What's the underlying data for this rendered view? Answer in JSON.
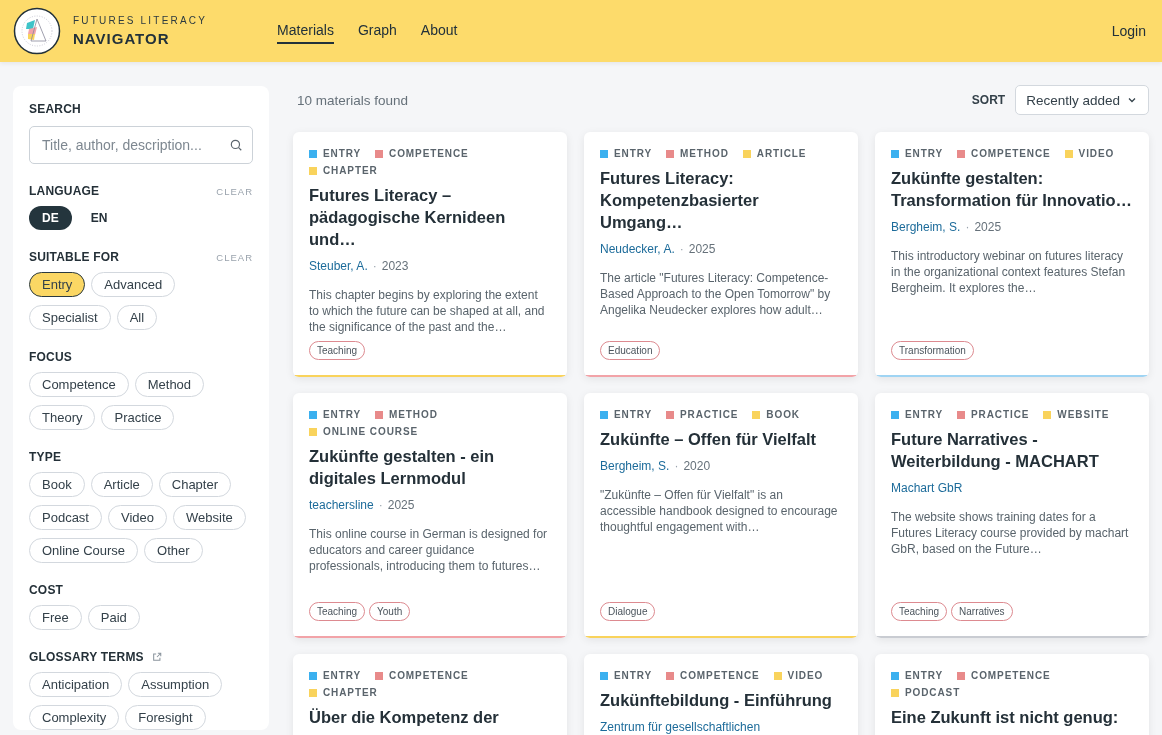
{
  "header": {
    "brand_top": "FUTURES LITERACY",
    "brand_main": "NAVIGATOR",
    "nav": [
      {
        "label": "Materials",
        "selected": true
      },
      {
        "label": "Graph",
        "selected": false
      },
      {
        "label": "About",
        "selected": false
      }
    ],
    "login": "Login"
  },
  "sidebar": {
    "search": {
      "title": "SEARCH",
      "placeholder": "Title, author, description..."
    },
    "sections": [
      {
        "title": "LANGUAGE",
        "kind": "toggle",
        "clear": "CLEAR",
        "options": [
          {
            "label": "DE",
            "selected": true
          },
          {
            "label": "EN",
            "selected": false
          }
        ]
      },
      {
        "title": "SUITABLE FOR",
        "kind": "chips",
        "clear": "CLEAR",
        "options": [
          {
            "label": "Entry",
            "selected": true
          },
          {
            "label": "Advanced",
            "selected": false
          },
          {
            "label": "Specialist",
            "selected": false
          },
          {
            "label": "All",
            "selected": false
          }
        ]
      },
      {
        "title": "FOCUS",
        "kind": "chips",
        "options": [
          {
            "label": "Competence",
            "selected": false
          },
          {
            "label": "Method",
            "selected": false
          },
          {
            "label": "Theory",
            "selected": false
          },
          {
            "label": "Practice",
            "selected": false
          }
        ]
      },
      {
        "title": "TYPE",
        "kind": "chips",
        "options": [
          {
            "label": "Book",
            "selected": false
          },
          {
            "label": "Article",
            "selected": false
          },
          {
            "label": "Chapter",
            "selected": false
          },
          {
            "label": "Podcast",
            "selected": false
          },
          {
            "label": "Video",
            "selected": false
          },
          {
            "label": "Website",
            "selected": false
          },
          {
            "label": "Online Course",
            "selected": false
          },
          {
            "label": "Other",
            "selected": false
          }
        ]
      },
      {
        "title": "COST",
        "kind": "chips",
        "options": [
          {
            "label": "Free",
            "selected": false
          },
          {
            "label": "Paid",
            "selected": false
          }
        ]
      },
      {
        "title": "GLOSSARY TERMS",
        "kind": "chips",
        "external_link": true,
        "options": [
          {
            "label": "Anticipation",
            "selected": false
          },
          {
            "label": "Assumption",
            "selected": false
          },
          {
            "label": "Complexity",
            "selected": false
          },
          {
            "label": "Foresight",
            "selected": false
          }
        ]
      }
    ]
  },
  "results": {
    "count": "10 materials found",
    "sort_label": "SORT",
    "sort_value": "Recently added",
    "cards": [
      {
        "color": "#f9d35c",
        "tags": [
          {
            "label": "ENTRY",
            "color": "#3bb0ef"
          },
          {
            "label": "COMPETENCE",
            "color": "#e88a8a"
          },
          {
            "label": "CHAPTER",
            "color": "#f9d35c"
          }
        ],
        "title": "Futures Literacy – pädagogische Kernideen und…",
        "author": "Steuber, A.",
        "separator": "·",
        "year": "2023",
        "description": "This chapter begins by exploring the extent to which the future can be shaped at all, and the significance of the past and the…",
        "keywords": [
          "Teaching"
        ]
      },
      {
        "color": "#f2a3a8",
        "tags": [
          {
            "label": "ENTRY",
            "color": "#3bb0ef"
          },
          {
            "label": "METHOD",
            "color": "#e88a8a"
          },
          {
            "label": "ARTICLE",
            "color": "#f9d35c"
          }
        ],
        "title": "Futures Literacy: Kompetenzbasierter Umgang…",
        "author": "Neudecker, A.",
        "separator": "·",
        "year": "2025",
        "description": "The article \"Futures Literacy: Competence-Based Approach to the Open Tomorrow\" by Angelika Neudecker explores how adult…",
        "keywords": [
          "Education"
        ]
      },
      {
        "color": "#9fd4f3",
        "tags": [
          {
            "label": "ENTRY",
            "color": "#3bb0ef"
          },
          {
            "label": "COMPETENCE",
            "color": "#e88a8a"
          },
          {
            "label": "VIDEO",
            "color": "#f9d35c"
          }
        ],
        "title": "Zukünfte gestalten: Transformation für Innovatio…",
        "author": "Bergheim, S.",
        "separator": "·",
        "year": "2025",
        "description": "This introductory webinar on futures literacy in the organizational context features Stefan Bergheim. It explores the…",
        "keywords": [
          "Transformation"
        ]
      },
      {
        "color": "#f2a3a8",
        "tags": [
          {
            "label": "ENTRY",
            "color": "#3bb0ef"
          },
          {
            "label": "METHOD",
            "color": "#e88a8a"
          },
          {
            "label": "ONLINE COURSE",
            "color": "#f9d35c"
          }
        ],
        "title": "Zukünfte gestalten - ein digitales Lernmodul",
        "author": "teachersline",
        "separator": "·",
        "year": "2025",
        "description": "This online course in German is designed for educators and career guidance professionals, introducing them to futures…",
        "keywords": [
          "Teaching",
          "Youth"
        ]
      },
      {
        "color": "#f9d35c",
        "tags": [
          {
            "label": "ENTRY",
            "color": "#3bb0ef"
          },
          {
            "label": "PRACTICE",
            "color": "#e88a8a"
          },
          {
            "label": "BOOK",
            "color": "#f9d35c"
          }
        ],
        "title": "Zukünfte – Offen für Vielfalt",
        "author": "Bergheim, S.",
        "separator": "·",
        "year": "2020",
        "description": "\"Zukünfte – Offen für Vielfalt\" is an accessible handbook designed to encourage thoughtful engagement with…",
        "keywords": [
          "Dialogue"
        ]
      },
      {
        "color": "#c9ccd2",
        "tags": [
          {
            "label": "ENTRY",
            "color": "#3bb0ef"
          },
          {
            "label": "PRACTICE",
            "color": "#e88a8a"
          },
          {
            "label": "WEBSITE",
            "color": "#f9d35c"
          }
        ],
        "title": "Future Narratives - Weiterbildung - MACHART",
        "author": "Machart GbR",
        "description": "The website shows training dates for a Futures Literacy course provided by machart GbR, based on the Future…",
        "keywords": [
          "Teaching",
          "Narratives"
        ]
      },
      {
        "tags": [
          {
            "label": "ENTRY",
            "color": "#3bb0ef"
          },
          {
            "label": "COMPETENCE",
            "color": "#e88a8a"
          },
          {
            "label": "CHAPTER",
            "color": "#f9d35c"
          }
        ],
        "title": "Über die Kompetenz der"
      },
      {
        "tags": [
          {
            "label": "ENTRY",
            "color": "#3bb0ef"
          },
          {
            "label": "COMPETENCE",
            "color": "#e88a8a"
          },
          {
            "label": "VIDEO",
            "color": "#f9d35c"
          }
        ],
        "title": "Zukünftebildung - Einführung",
        "author": "Zentrum für gesellschaftlichen"
      },
      {
        "tags": [
          {
            "label": "ENTRY",
            "color": "#3bb0ef"
          },
          {
            "label": "COMPETENCE",
            "color": "#e88a8a"
          },
          {
            "label": "PODCAST",
            "color": "#f9d35c"
          }
        ],
        "title": "Eine Zukunft ist nicht genug:"
      }
    ]
  }
}
